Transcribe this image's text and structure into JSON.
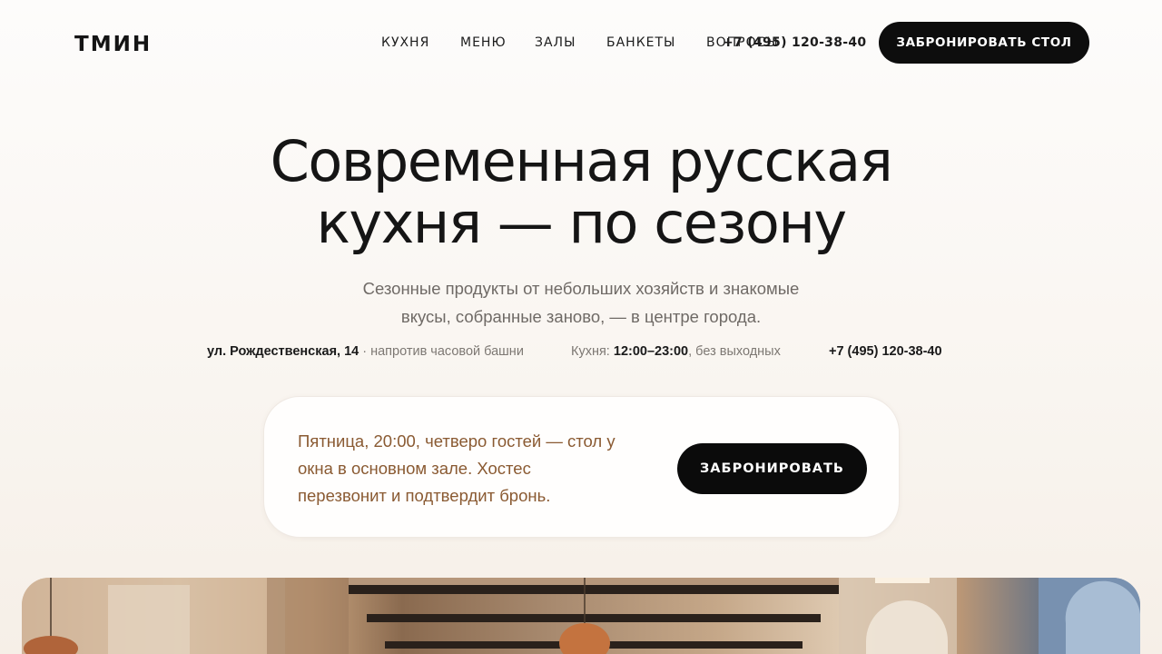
{
  "header": {
    "logo": "ТМИН",
    "nav": [
      "КУХНЯ",
      "МЕНЮ",
      "ЗАЛЫ",
      "БАНКЕТЫ",
      "ВОПРОСЫ"
    ],
    "phone": "+7 (495) 120-38-40",
    "cta": "ЗАБРОНИРОВАТЬ СТОЛ"
  },
  "hero": {
    "title_lines": [
      "Современная русская",
      "кухня — по сезону"
    ],
    "subtitle_lines": [
      "Сезонные продукты от небольших хозяйств и знакомые",
      "вкусы, собранные заново, — в центре города."
    ]
  },
  "info": {
    "address": "ул. Рождественская, 14",
    "address_note": " · напротив часовой башни",
    "hours_label": "Кухня: ",
    "hours": "12:00–23:00",
    "hours_note": ", без выходных",
    "phone": "+7 (495) 120-38-40"
  },
  "booking": {
    "text_lines": [
      "Пятница, 20:00, четверо гостей — стол у",
      "окна в основном зале. Хостес",
      "перезвонит и подтвердит бронь."
    ],
    "button": "ЗАБРОНИРОВАТЬ"
  },
  "colors": {
    "accent_text": "#8a5a32",
    "button_bg": "#0d0d0d",
    "muted_text": "#6f6a66"
  }
}
